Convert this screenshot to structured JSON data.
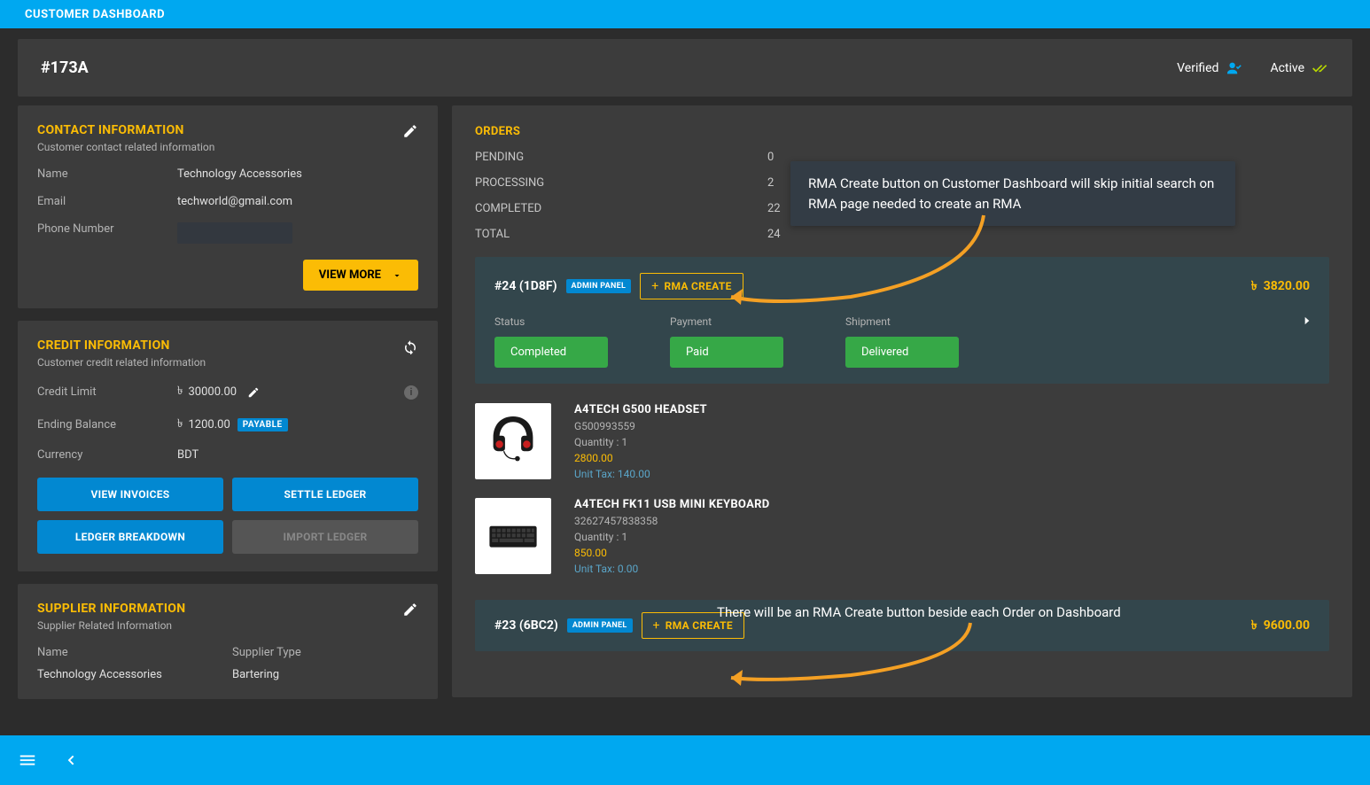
{
  "topbar": {
    "title": "CUSTOMER DASHBOARD"
  },
  "header": {
    "customer_id": "#173A",
    "verified_label": "Verified",
    "active_label": "Active"
  },
  "contact": {
    "title": "CONTACT INFORMATION",
    "subtitle": "Customer contact related information",
    "name_label": "Name",
    "name_value": "Technology Accessories",
    "email_label": "Email",
    "email_value": "techworld@gmail.com",
    "phone_label": "Phone Number",
    "view_more": "VIEW MORE"
  },
  "credit": {
    "title": "CREDIT INFORMATION",
    "subtitle": "Customer credit related information",
    "limit_label": "Credit Limit",
    "limit_currency": "৳",
    "limit_value": "30000.00",
    "balance_label": "Ending Balance",
    "balance_currency": "৳",
    "balance_value": "1200.00",
    "payable_badge": "PAYABLE",
    "currency_label": "Currency",
    "currency_value": "BDT",
    "btn_view_invoices": "VIEW INVOICES",
    "btn_settle_ledger": "SETTLE LEDGER",
    "btn_ledger_breakdown": "LEDGER BREAKDOWN",
    "btn_import_ledger": "IMPORT LEDGER"
  },
  "supplier": {
    "title": "SUPPLIER INFORMATION",
    "subtitle": "Supplier Related Information",
    "name_label": "Name",
    "type_label": "Supplier Type",
    "name_value": "Technology Accessories",
    "type_value": "Bartering"
  },
  "orders": {
    "title": "ORDERS",
    "stats": {
      "pending_label": "PENDING",
      "pending_value": "0",
      "processing_label": "PROCESSING",
      "processing_value": "2",
      "completed_label": "COMPLETED",
      "completed_value": "22",
      "total_label": "TOTAL",
      "total_value": "24"
    },
    "card1": {
      "id": "#24 (1D8F)",
      "admin_badge": "ADMIN PANEL",
      "rma_label": "RMA CREATE",
      "amount_currency": "৳",
      "amount": "3820.00",
      "status_label": "Status",
      "status_value": "Completed",
      "payment_label": "Payment",
      "payment_value": "Paid",
      "shipment_label": "Shipment",
      "shipment_value": "Delivered"
    },
    "items": [
      {
        "name": "A4TECH G500 HEADSET",
        "sku": "G500993559",
        "qty_label": "Quantity : 1",
        "price": "2800.00",
        "tax": "Unit Tax: 140.00"
      },
      {
        "name": "A4TECH FK11 USB MINI KEYBOARD",
        "sku": "32627457838358",
        "qty_label": "Quantity : 1",
        "price": "850.00",
        "tax": "Unit Tax: 0.00"
      }
    ],
    "card2": {
      "id": "#23 (6BC2)",
      "admin_badge": "ADMIN PANEL",
      "rma_label": "RMA CREATE",
      "amount_currency": "৳",
      "amount": "9600.00"
    }
  },
  "annotations": {
    "callout1": "RMA Create button on Customer Dashboard will skip initial search on RMA page needed to create an RMA",
    "callout2": "There will be an RMA Create button beside each Order on Dashboard"
  }
}
